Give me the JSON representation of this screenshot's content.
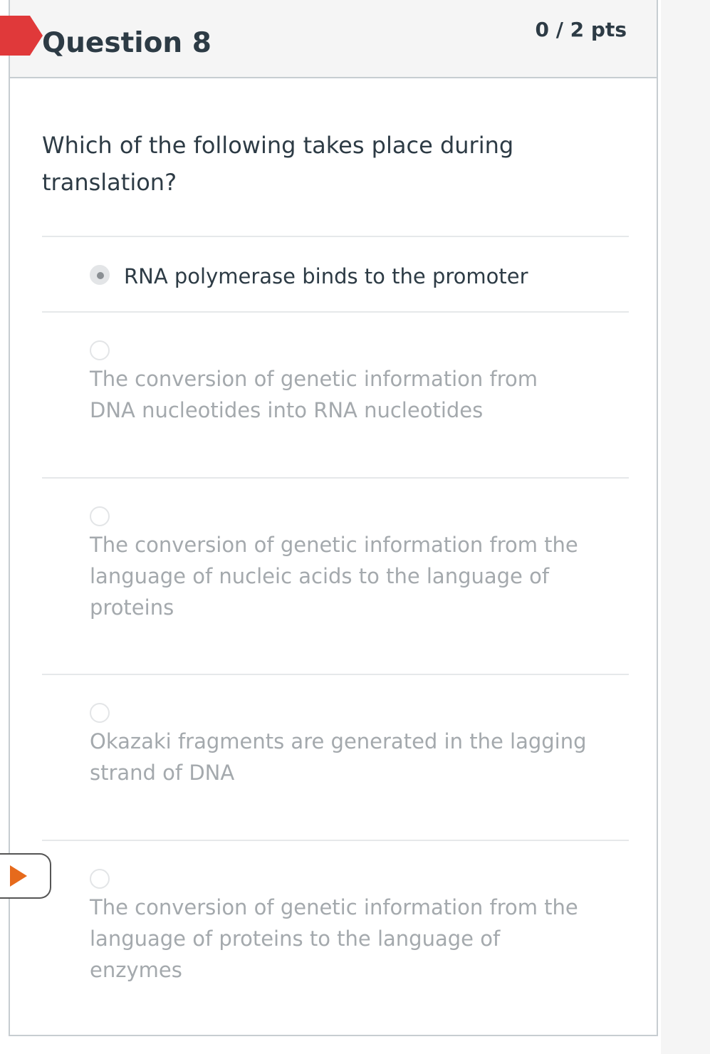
{
  "question": {
    "title": "Question 8",
    "points": "0 / 2 pts",
    "text": "Which of the following takes place during translation?"
  },
  "answers": [
    {
      "label": "RNA polymerase binds to the promoter",
      "selected": true
    },
    {
      "label": "The conversion of genetic information from DNA nucleotides into RNA nucleotides",
      "selected": false
    },
    {
      "label": "The conversion of genetic information from the language of nucleic acids to the language of proteins",
      "selected": false
    },
    {
      "label": "Okazaki fragments are generated in the lagging strand of DNA",
      "selected": false
    },
    {
      "label": "The conversion of genetic information from the language of proteins to the language of enzymes",
      "selected": false
    }
  ],
  "colors": {
    "flag": "#e0393a",
    "marker": "#e66a1c",
    "text": "#2d3b45",
    "muted": "#a4a9ad"
  },
  "icons": {
    "flag": "flag-icon",
    "current": "play-icon"
  }
}
